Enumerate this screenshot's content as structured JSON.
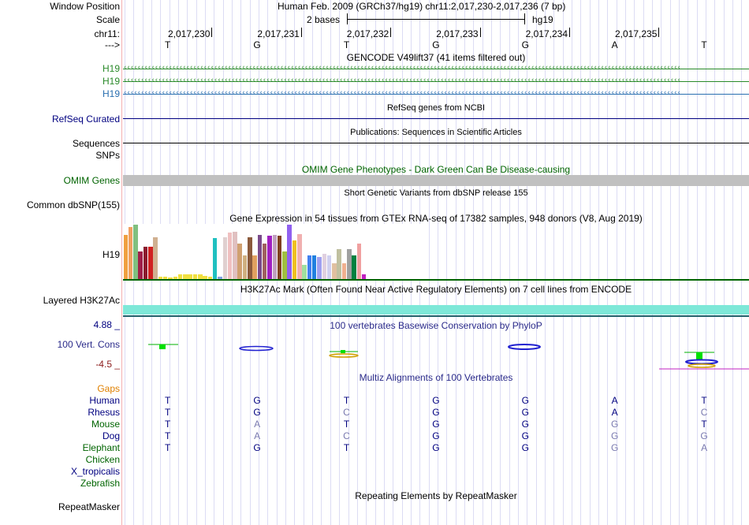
{
  "header": {
    "window_position_label": "Window Position",
    "window_position_value": "Human Feb. 2009 (GRCh37/hg19)   chr11:2,017,230-2,017,236 (7 bp)",
    "scale_label": "Scale",
    "scale_value": "2 bases",
    "scale_assembly": "hg19",
    "chrom_label": "chr11:",
    "ruler_positions": [
      "2,017,230",
      "2,017,231",
      "2,017,232",
      "2,017,233",
      "2,017,234",
      "2,017,235"
    ],
    "strand_label": "--->",
    "bases": [
      "T",
      "G",
      "T",
      "G",
      "G",
      "A",
      "T"
    ]
  },
  "tracks": {
    "gencode": {
      "title": "GENCODE V49lift37 (41 items filtered out)",
      "genes": [
        {
          "name": "H19",
          "color": "#2a8a2a"
        },
        {
          "name": "H19",
          "color": "#2a8a2a"
        },
        {
          "name": "H19",
          "color": "#2a6fb0"
        }
      ]
    },
    "refseq": {
      "title": "RefSeq genes from NCBI",
      "label": "RefSeq Curated",
      "color": "#000080"
    },
    "publications": {
      "title": "Publications: Sequences in Scientific Articles",
      "label": "Sequences"
    },
    "snps": {
      "label": "SNPs"
    },
    "omim": {
      "title": "OMIM Gene Phenotypes - Dark Green Can Be Disease-causing",
      "label": "OMIM Genes",
      "color": "#006400",
      "bar_color": "#c0c0c0"
    },
    "dbsnp": {
      "title": "Short Genetic Variants from dbSNP release 155",
      "label": "Common dbSNP(155)"
    },
    "gtex": {
      "title": "Gene Expression in 54 tissues from GTEx RNA-seq of 17382 samples, 948 donors (V8, Aug 2019)",
      "label": "H19",
      "bars": [
        {
          "v": 0.8,
          "c": "#f0a040"
        },
        {
          "v": 0.94,
          "c": "#f0a060"
        },
        {
          "v": 0.98,
          "c": "#80c080"
        },
        {
          "v": 0.5,
          "c": "#a0204a"
        },
        {
          "v": 0.58,
          "c": "#8b1a2e"
        },
        {
          "v": 0.58,
          "c": "#d02020"
        },
        {
          "v": 0.76,
          "c": "#d0b090"
        },
        {
          "v": 0.05,
          "c": "#f0e040"
        },
        {
          "v": 0.05,
          "c": "#f0e040"
        },
        {
          "v": 0.03,
          "c": "#f0e040"
        },
        {
          "v": 0.04,
          "c": "#f0e040"
        },
        {
          "v": 0.08,
          "c": "#f0e040"
        },
        {
          "v": 0.08,
          "c": "#f0e040"
        },
        {
          "v": 0.08,
          "c": "#f0e040"
        },
        {
          "v": 0.08,
          "c": "#f0e040"
        },
        {
          "v": 0.08,
          "c": "#f0e040"
        },
        {
          "v": 0.06,
          "c": "#f0e040"
        },
        {
          "v": 0.04,
          "c": "#f0e040"
        },
        {
          "v": 0.74,
          "c": "#20c0c0"
        },
        {
          "v": 0.04,
          "c": "#80a0e0"
        },
        {
          "v": 0.76,
          "c": "#e0d0d0"
        },
        {
          "v": 0.84,
          "c": "#f0c0c0"
        },
        {
          "v": 0.86,
          "c": "#e0c0c0"
        },
        {
          "v": 0.64,
          "c": "#d0a070"
        },
        {
          "v": 0.43,
          "c": "#d0b080"
        },
        {
          "v": 0.76,
          "c": "#8b5a3c"
        },
        {
          "v": 0.43,
          "c": "#e0a060"
        },
        {
          "v": 0.8,
          "c": "#7a4a8a"
        },
        {
          "v": 0.64,
          "c": "#a06060"
        },
        {
          "v": 0.78,
          "c": "#a020c0"
        },
        {
          "v": 0.8,
          "c": "#c0a0c0"
        },
        {
          "v": 0.78,
          "c": "#804020"
        },
        {
          "v": 0.5,
          "c": "#a0c040"
        },
        {
          "v": 0.98,
          "c": "#9060f0"
        },
        {
          "v": 0.7,
          "c": "#f0c020"
        },
        {
          "v": 0.82,
          "c": "#f0b0b0"
        },
        {
          "v": 0.26,
          "c": "#a0e0a0"
        },
        {
          "v": 0.43,
          "c": "#4080f0"
        },
        {
          "v": 0.43,
          "c": "#2080e0"
        },
        {
          "v": 0.4,
          "c": "#a0a0f0"
        },
        {
          "v": 0.46,
          "c": "#e0d0e0"
        },
        {
          "v": 0.43,
          "c": "#d0d0f0"
        },
        {
          "v": 0.29,
          "c": "#e0c0a0"
        },
        {
          "v": 0.54,
          "c": "#c0c0a0"
        },
        {
          "v": 0.29,
          "c": "#f0b090"
        },
        {
          "v": 0.54,
          "c": "#a0a0a0"
        },
        {
          "v": 0.43,
          "c": "#008040"
        },
        {
          "v": 0.64,
          "c": "#f0a0a0"
        },
        {
          "v": 0.09,
          "c": "#c020c0"
        }
      ]
    },
    "h3k27ac": {
      "title": "H3K27Ac Mark (Often Found Near Active Regulatory Elements) on 7 cell lines from ENCODE",
      "label": "Layered H3K27Ac",
      "color": "#7ee8d8"
    },
    "conservation": {
      "title": "100 vertebrates Basewise Conservation by PhyloP",
      "label": "100 Vert. Cons",
      "max_label": "4.88 _",
      "min_label": "-4.5 _"
    },
    "multiz": {
      "title": "Multiz Alignments of 100 Vertebrates",
      "gaps_label": "Gaps",
      "species": [
        {
          "name": "Human",
          "color": "#000080",
          "bases": [
            "T",
            "G",
            "T",
            "G",
            "G",
            "A",
            "T"
          ],
          "dim": [
            false,
            false,
            false,
            false,
            false,
            false,
            false
          ]
        },
        {
          "name": "Rhesus",
          "color": "#000080",
          "bases": [
            "T",
            "G",
            "C",
            "G",
            "G",
            "A",
            "C"
          ],
          "dim": [
            false,
            false,
            true,
            false,
            false,
            false,
            true
          ]
        },
        {
          "name": "Mouse",
          "color": "#006400",
          "bases": [
            "T",
            "A",
            "T",
            "G",
            "G",
            "G",
            "T"
          ],
          "dim": [
            false,
            true,
            false,
            false,
            false,
            true,
            false
          ]
        },
        {
          "name": "Dog",
          "color": "#000080",
          "bases": [
            "T",
            "A",
            "C",
            "G",
            "G",
            "G",
            "G"
          ],
          "dim": [
            false,
            true,
            true,
            false,
            false,
            true,
            true
          ]
        },
        {
          "name": "Elephant",
          "color": "#006400",
          "bases": [
            "T",
            "G",
            "T",
            "G",
            "G",
            "G",
            "A"
          ],
          "dim": [
            false,
            false,
            false,
            false,
            false,
            true,
            true
          ]
        },
        {
          "name": "Chicken",
          "color": "#006400",
          "bases": [],
          "dim": []
        },
        {
          "name": "X_tropicalis",
          "color": "#000080",
          "bases": [],
          "dim": []
        },
        {
          "name": "Zebrafish",
          "color": "#006400",
          "bases": [],
          "dim": []
        }
      ]
    },
    "repeatmasker": {
      "title": "Repeating Elements by RepeatMasker",
      "label": "RepeatMasker"
    }
  },
  "colors": {
    "base_dim": "#7a7ab0",
    "base_main": "#000080",
    "gaps": "#e08000",
    "cons_min": "#8b1a1a",
    "cons_max": "#000080"
  }
}
